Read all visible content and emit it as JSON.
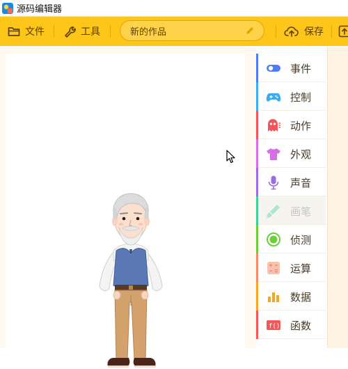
{
  "window": {
    "title": "源码编辑器"
  },
  "toolbar": {
    "file_label": "文件",
    "tools_label": "工具",
    "project_name": "新的作品",
    "save_label": "保存"
  },
  "categories": [
    {
      "label": "事件",
      "icon": "toggle-icon",
      "color": "#4f7cf2"
    },
    {
      "label": "控制",
      "icon": "gamepad-icon",
      "color": "#3aaef0"
    },
    {
      "label": "动作",
      "icon": "ghost-icon",
      "color": "#f2545b"
    },
    {
      "label": "外观",
      "icon": "shirt-icon",
      "color": "#d86de8"
    },
    {
      "label": "声音",
      "icon": "mic-icon",
      "color": "#9c6ce6"
    },
    {
      "label": "画笔",
      "icon": "brush-icon",
      "color": "#3ecf9c"
    },
    {
      "label": "侦测",
      "icon": "sensor-icon",
      "color": "#6ccf3a"
    },
    {
      "label": "运算",
      "icon": "calc-icon",
      "color": "#f58a6a"
    },
    {
      "label": "数据",
      "icon": "chart-icon",
      "color": "#f5a623"
    },
    {
      "label": "函数",
      "icon": "function-icon",
      "color": "#f25a5a"
    }
  ],
  "sprite": {
    "name": "old-man-sprite"
  }
}
